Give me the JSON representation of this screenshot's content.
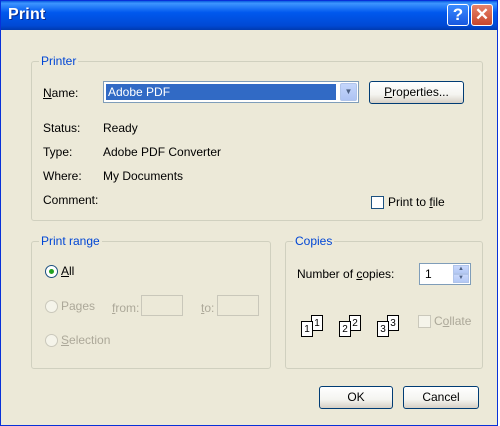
{
  "window": {
    "title": "Print"
  },
  "printer": {
    "group_label": "Printer",
    "name_label": "Name:",
    "name_value": "Adobe PDF",
    "properties_button": "Properties...",
    "status_label": "Status:",
    "status_value": "Ready",
    "type_label": "Type:",
    "type_value": "Adobe PDF Converter",
    "where_label": "Where:",
    "where_value": "My Documents",
    "comment_label": "Comment:",
    "comment_value": "",
    "print_to_file_label": "Print to file",
    "print_to_file_checked": false
  },
  "print_range": {
    "group_label": "Print range",
    "all_label": "All",
    "pages_label": "Pages",
    "from_label": "from:",
    "to_label": "to:",
    "from_value": "",
    "to_value": "",
    "selection_label": "Selection",
    "selected": "All"
  },
  "copies": {
    "group_label": "Copies",
    "number_label": "Number of copies:",
    "number_value": "1",
    "collate_label": "Collate",
    "collate_checked": false,
    "collate_pages": [
      "1",
      "1",
      "2",
      "2",
      "3",
      "3"
    ]
  },
  "buttons": {
    "ok": "OK",
    "cancel": "Cancel"
  },
  "icons": {
    "help": "help-icon",
    "close": "close-icon",
    "dropdown": "chevron-down-icon"
  }
}
